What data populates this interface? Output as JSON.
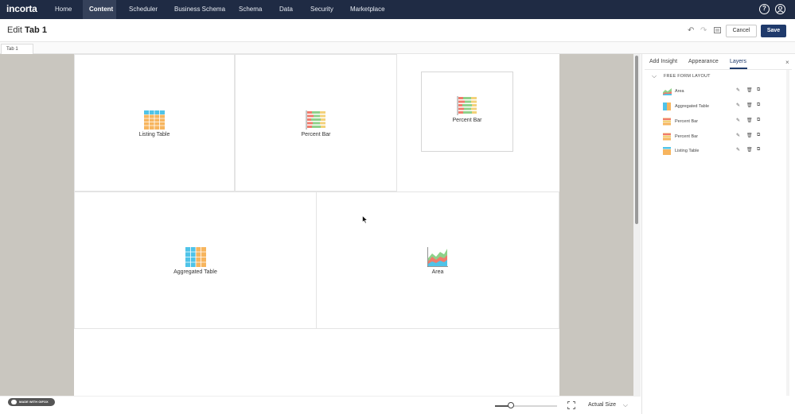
{
  "nav": {
    "logo": "incorta",
    "items": [
      {
        "label": "Home"
      },
      {
        "label": "Content",
        "active": true
      },
      {
        "label": "Scheduler"
      },
      {
        "label": "Business Schema"
      },
      {
        "label": "Schema"
      },
      {
        "label": "Data"
      },
      {
        "label": "Security"
      },
      {
        "label": "Marketplace"
      }
    ],
    "help_icon": "help-icon",
    "user_icon": "user-icon"
  },
  "header": {
    "edit_prefix": "Edit",
    "tab_name": "Tab 1",
    "cancel_label": "Cancel",
    "save_label": "Save"
  },
  "tabs": [
    "Tab 1"
  ],
  "canvas": {
    "insights": [
      {
        "label": "Listing Table",
        "icon": "listing-table-icon"
      },
      {
        "label": "Percent Bar",
        "icon": "percent-bar-icon"
      },
      {
        "label": "Percent Bar",
        "icon": "percent-bar-icon"
      },
      {
        "label": "Aggregated Table",
        "icon": "aggregated-table-icon"
      },
      {
        "label": "Area",
        "icon": "area-chart-icon"
      }
    ]
  },
  "bottom": {
    "badge": "MADE WITH GIFOX",
    "zoom_size": "Actual Size"
  },
  "panel": {
    "tabs": [
      "Add Insight",
      "Appearance",
      "Layers"
    ],
    "active_tab": "Layers",
    "section": "FREE FORM LAYOUT",
    "layers": [
      {
        "name": "Area",
        "icon": "area-chart-icon"
      },
      {
        "name": "Aggregated Table",
        "icon": "aggregated-table-icon"
      },
      {
        "name": "Percent Bar",
        "icon": "percent-bar-icon"
      },
      {
        "name": "Percent Bar",
        "icon": "percent-bar-icon"
      },
      {
        "name": "Listing Table",
        "icon": "listing-table-icon"
      }
    ]
  },
  "colors": {
    "nav_bg": "#1f2b44",
    "accent": "#1f3a6b",
    "canvas_bg": "#c9c6bf",
    "table_blue": "#4fc3e8",
    "table_orange": "#f7b55e",
    "bar_red": "#f07b6c",
    "bar_green": "#8fd18a",
    "bar_yellow": "#f3d27a"
  }
}
